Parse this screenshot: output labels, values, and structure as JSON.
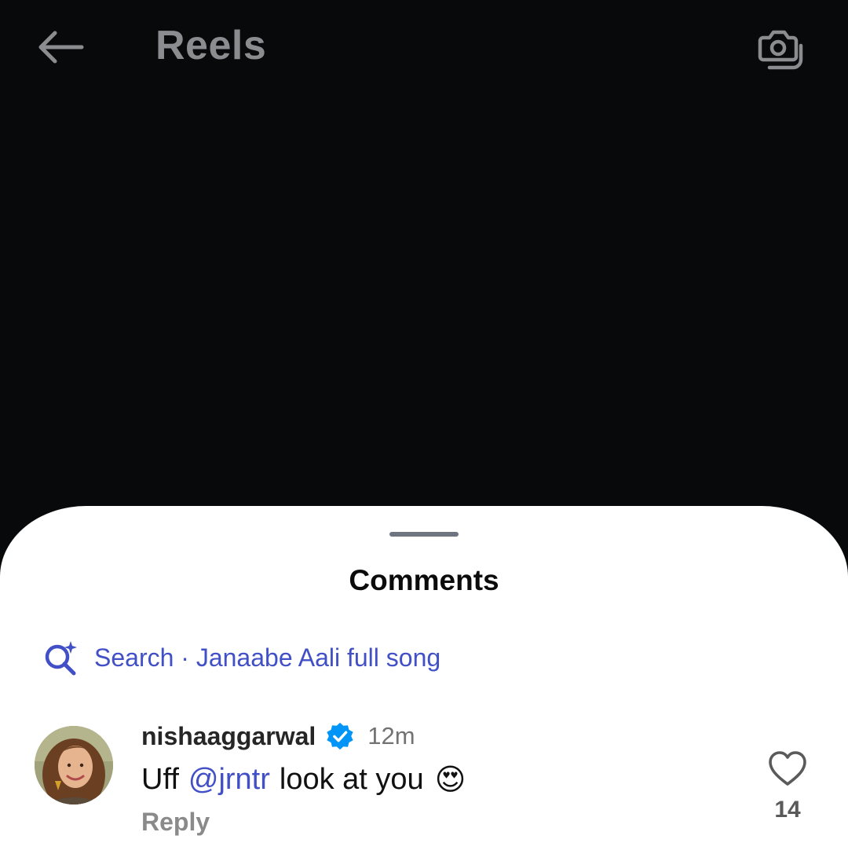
{
  "header": {
    "title": "Reels",
    "back_icon": "arrow-left-icon",
    "camera_icon": "camera-icon"
  },
  "sheet": {
    "title": "Comments",
    "search": {
      "icon": "ai-search-icon",
      "text": "Search · Janaabe Aali full song"
    }
  },
  "comments": [
    {
      "username": "nishaaggarwal",
      "verified": true,
      "time": "12m",
      "text_before": "Uff",
      "mention": "@jrntr",
      "text_after": "look at you",
      "emoji": "😍",
      "reply_label": "Reply",
      "likes": "14"
    }
  ],
  "colors": {
    "background": "#08090b",
    "sheet": "#ffffff",
    "accent": "#4150c6",
    "verified": "#0095f6"
  }
}
